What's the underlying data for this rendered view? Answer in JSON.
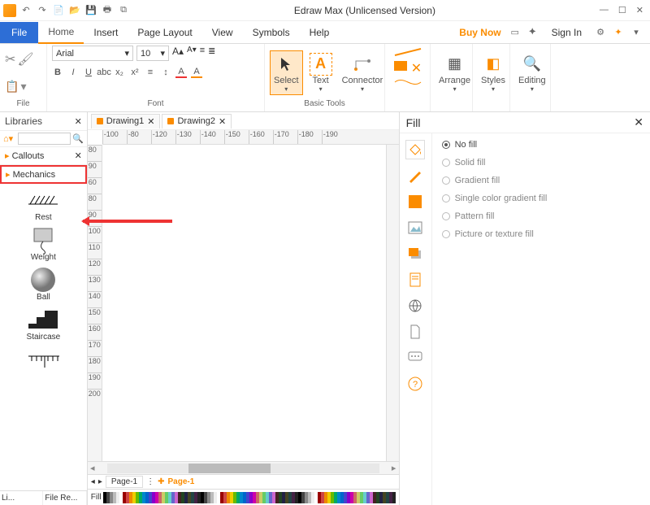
{
  "title": "Edraw Max (Unlicensed Version)",
  "menu": {
    "file": "File",
    "items": [
      "Home",
      "Insert",
      "Page Layout",
      "View",
      "Symbols",
      "Help"
    ],
    "active": "Home"
  },
  "right_menu": {
    "buy": "Buy Now",
    "signin": "Sign In"
  },
  "ribbon": {
    "file_group": "File",
    "font_group": "Font",
    "font_name": "Arial",
    "font_size": "10",
    "basic_group": "Basic Tools",
    "select": "Select",
    "text": "Text",
    "connector": "Connector",
    "arrange": "Arrange",
    "styles": "Styles",
    "editing": "Editing"
  },
  "libraries": {
    "title": "Libraries",
    "cat1": "Callouts",
    "cat2": "Mechanics",
    "shapes": [
      "Rest",
      "Weight",
      "Ball",
      "Staircase"
    ],
    "bottom1": "Li...",
    "bottom2": "File Re..."
  },
  "docs": {
    "tab1": "Drawing1",
    "tab2": "Drawing2"
  },
  "hruler": [
    "-100",
    "-80",
    "-120",
    "-130",
    "-140",
    "-150",
    "-160",
    "-170",
    "-180",
    "-190"
  ],
  "vruler": [
    "80",
    "90",
    "60",
    "80",
    "90",
    "100",
    "110",
    "120",
    "130",
    "140",
    "150",
    "160",
    "170",
    "180",
    "190",
    "200"
  ],
  "page_strip": {
    "page": "Page-1",
    "name": "Page-1"
  },
  "fill_label": "Fill",
  "fill_panel": {
    "title": "Fill",
    "opts": [
      "No fill",
      "Solid fill",
      "Gradient fill",
      "Single color gradient fill",
      "Pattern fill",
      "Picture or texture fill"
    ],
    "selected": 0
  },
  "colors": [
    "#000",
    "#444",
    "#888",
    "#bbb",
    "#eee",
    "#fff",
    "#900",
    "#c44",
    "#e80",
    "#ec0",
    "#6b0",
    "#0a6",
    "#08c",
    "#06c",
    "#44c",
    "#80c",
    "#c0a",
    "#c66",
    "#cc6",
    "#6c6",
    "#6cc",
    "#66c",
    "#c6c",
    "#422",
    "#242",
    "#224",
    "#442",
    "#244",
    "#424",
    "#222"
  ]
}
